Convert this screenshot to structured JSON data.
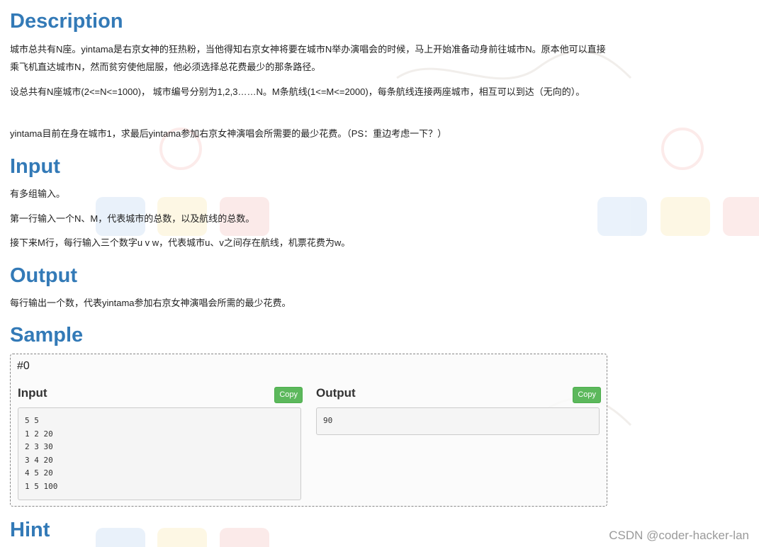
{
  "description": {
    "title": "Description",
    "paragraphs": [
      "城市总共有N座。yintama是右京女神的狂热粉，当他得知右京女神将要在城市N举办演唱会的时候，马上开始准备动身前往城市N。原本他可以直接乘飞机直达城市N，然而贫穷使他屈服，他必须选择总花费最少的那条路径。",
      "设总共有N座城市(2<=N<=1000)， 城市编号分别为1,2,3……N。M条航线(1<=M<=2000)，每条航线连接两座城市，相互可以到达（无向的）。",
      "yintama目前在身在城市1，求最后yintama参加右京女神演唱会所需要的最少花费。（PS：重边考虑一下？）"
    ]
  },
  "input_section": {
    "title": "Input",
    "paragraphs": [
      "有多组输入。",
      "第一行输入一个N、M，代表城市的总数，以及航线的总数。",
      "接下来M行，每行输入三个数字u v w，代表城市u、v之间存在航线，机票花费为w。"
    ]
  },
  "output_section": {
    "title": "Output",
    "paragraphs": [
      "每行输出一个数，代表yintama参加右京女神演唱会所需的最少花费。"
    ]
  },
  "sample": {
    "title": "Sample",
    "id": "#0",
    "input_label": "Input",
    "output_label": "Output",
    "copy_label": "Copy",
    "input_lines": [
      "5 5",
      "1 2 20",
      "2 3 30",
      "3 4 20",
      "4 5 20",
      "1 5 100"
    ],
    "output_lines": [
      "90"
    ]
  },
  "hint": {
    "title": "Hint"
  },
  "watermark": "CSDN @coder-hacker-lan"
}
